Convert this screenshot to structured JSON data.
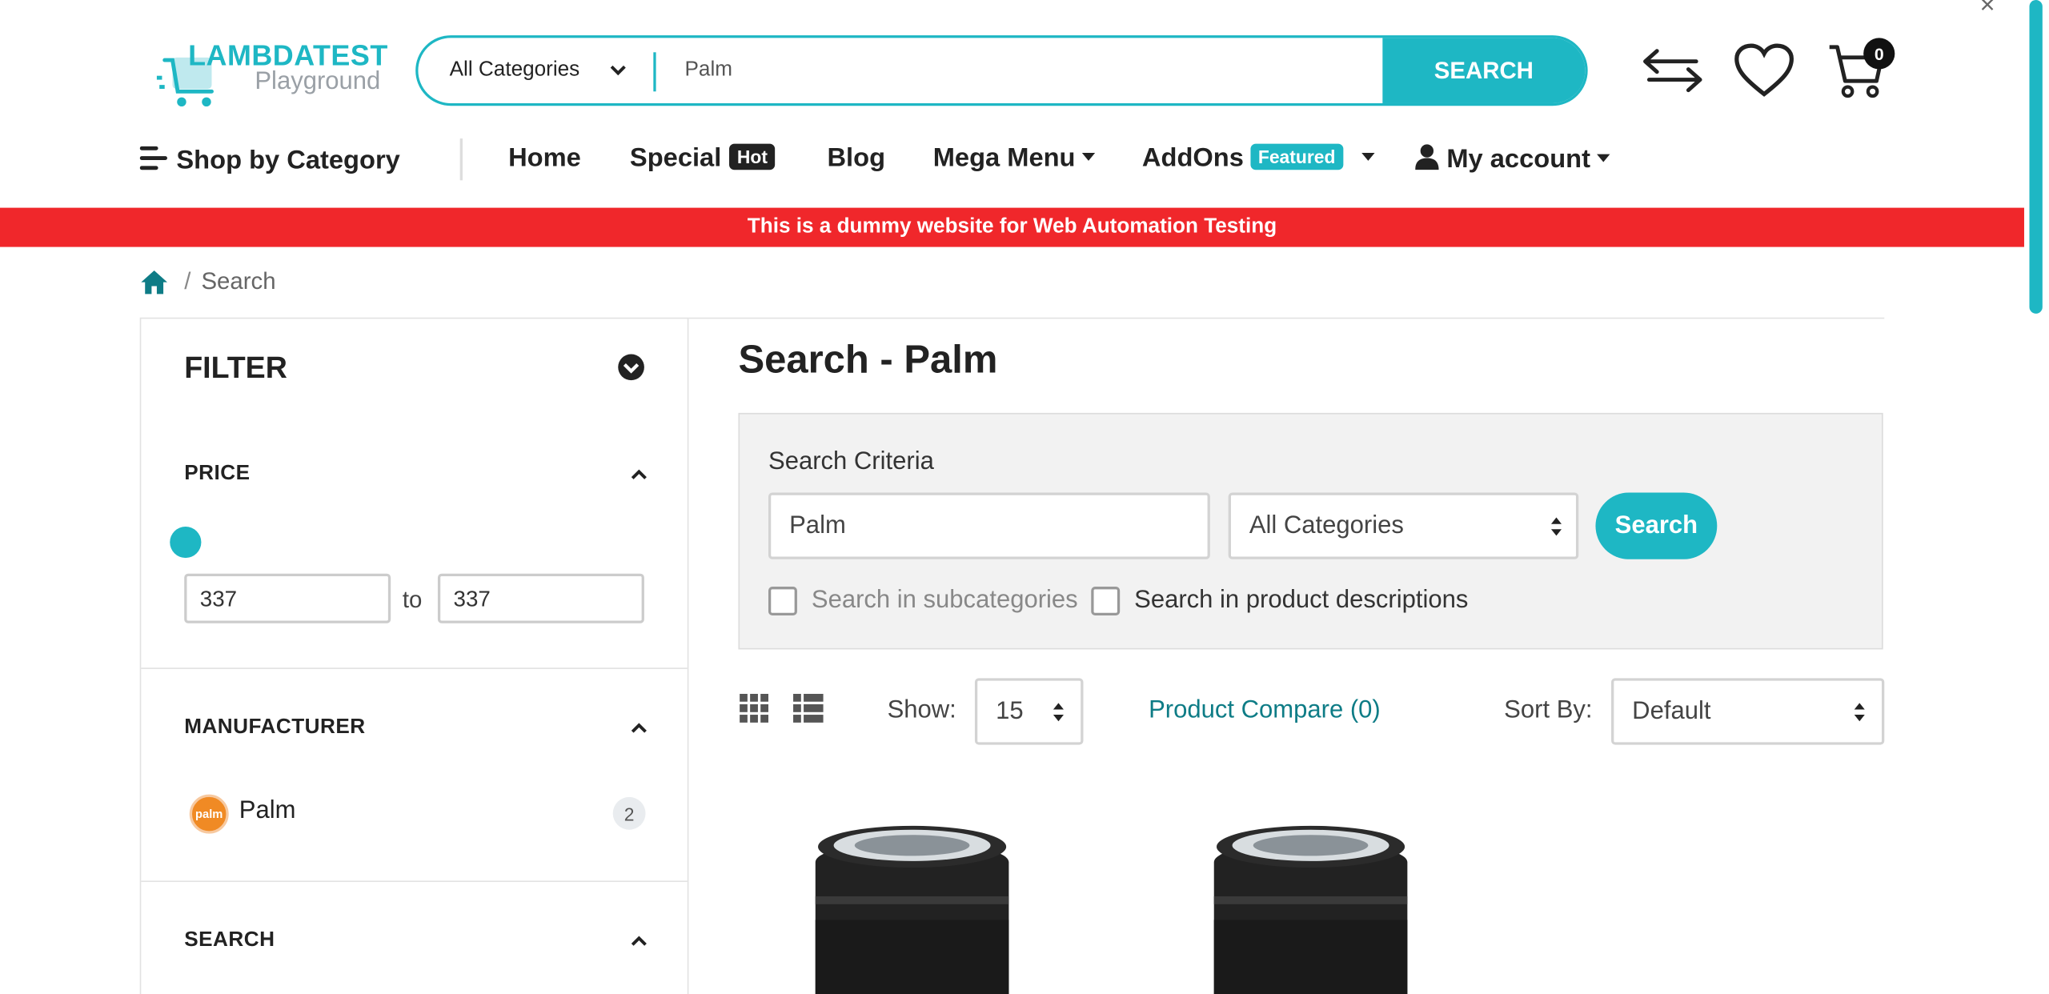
{
  "header": {
    "logo_title": "LAMBDATEST",
    "logo_subtitle": "Playground",
    "search_category": "All Categories",
    "search_value": "Palm",
    "search_button": "SEARCH",
    "cart_count": "0"
  },
  "nav": {
    "shop_by_category": "Shop by Category",
    "home": "Home",
    "special": "Special",
    "special_badge": "Hot",
    "blog": "Blog",
    "mega_menu": "Mega Menu",
    "addons": "AddOns",
    "addons_badge": "Featured",
    "my_account": "My account"
  },
  "banner": "This is a dummy website for Web Automation Testing",
  "breadcrumb": {
    "separator": "/",
    "current": "Search"
  },
  "sidebar": {
    "filter_title": "FILTER",
    "price_heading": "PRICE",
    "price_min": "337",
    "price_to": "to",
    "price_max": "337",
    "manufacturer_heading": "MANUFACTURER",
    "manufacturer_name": "Palm",
    "manufacturer_logo_text": "palm",
    "manufacturer_count": "2",
    "search_heading": "SEARCH"
  },
  "main": {
    "title": "Search - Palm",
    "criteria_label": "Search Criteria",
    "criteria_value": "Palm",
    "criteria_category": "All Categories",
    "criteria_button": "Search",
    "subcategories_label": "Search in subcategories",
    "descriptions_label": "Search in product descriptions",
    "show_label": "Show:",
    "show_value": "15",
    "compare_link": "Product Compare (0)",
    "sort_label": "Sort By:",
    "sort_value": "Default"
  },
  "colors": {
    "accent": "#1eb7c4",
    "banner": "#f0272b",
    "link": "#0e7c86"
  }
}
